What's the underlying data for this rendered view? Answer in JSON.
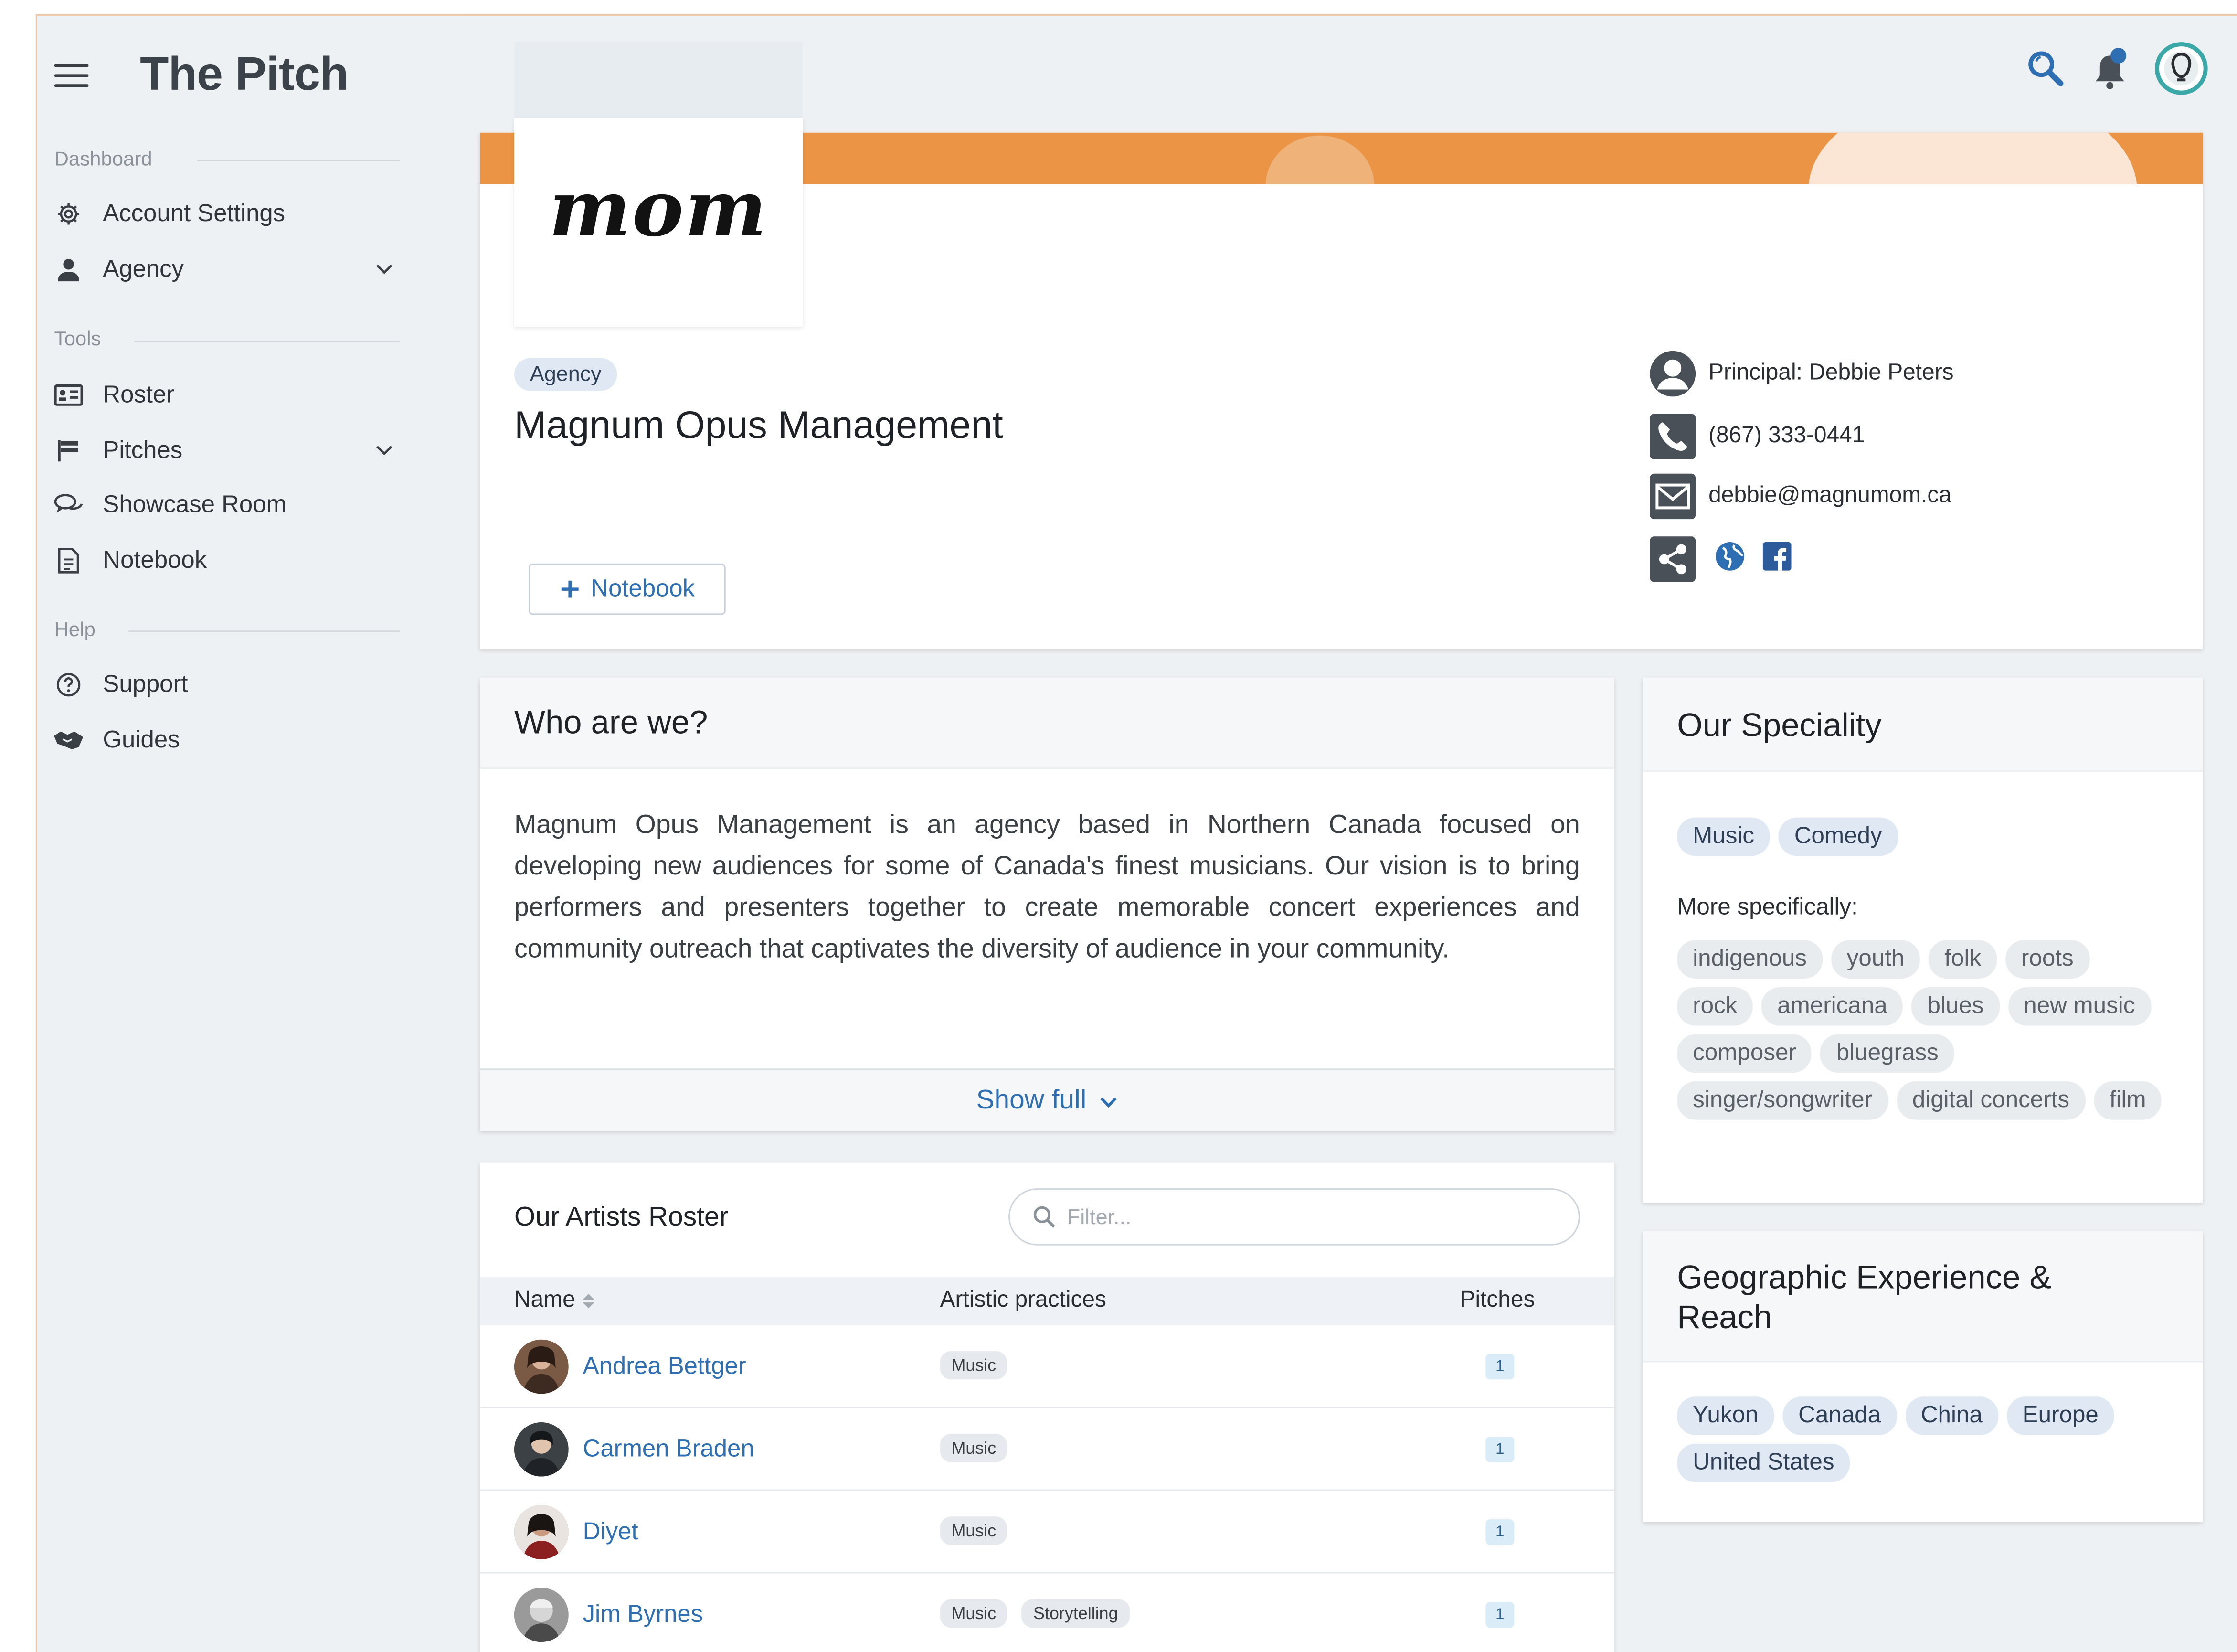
{
  "app": {
    "title": "The Pitch"
  },
  "sidebar": {
    "sections": [
      {
        "label": "Dashboard"
      },
      {
        "label": "Tools"
      },
      {
        "label": "Help"
      }
    ],
    "items": [
      {
        "label": "Account Settings",
        "icon": "gear-icon"
      },
      {
        "label": "Agency",
        "icon": "person-icon",
        "expandable": true
      },
      {
        "label": "Roster",
        "icon": "id-card-icon"
      },
      {
        "label": "Pitches",
        "icon": "flag-icon",
        "expandable": true
      },
      {
        "label": "Showcase Room",
        "icon": "chat-icon"
      },
      {
        "label": "Notebook",
        "icon": "document-icon"
      },
      {
        "label": "Support",
        "icon": "question-icon"
      },
      {
        "label": "Guides",
        "icon": "handshake-icon"
      }
    ]
  },
  "topbar": {
    "icons": [
      "search-icon",
      "bell-icon",
      "avatar-icon"
    ]
  },
  "profile": {
    "logo_text": "mom",
    "type_badge": "Agency",
    "name": "Magnum Opus Management",
    "notebook_button": "Notebook",
    "principal": "Principal: Debbie Peters",
    "phone": "(867) 333-0441",
    "email": "debbie@magnumom.ca"
  },
  "about": {
    "title": "Who are we?",
    "text": "Magnum Opus Management is an agency based in Northern Canada focused on developing new audiences for some of Canada's finest musicians. Our vision is to bring performers and presenters together to create memorable concert experiences and community outreach that captivates the diversity of audience in your community.",
    "show_full": "Show full"
  },
  "specialty": {
    "title": "Our Speciality",
    "primary": [
      "Music",
      "Comedy"
    ],
    "more_label": "More specifically:",
    "tags": [
      "indigenous",
      "youth",
      "folk",
      "roots",
      "rock",
      "americana",
      "blues",
      "new music",
      "composer",
      "bluegrass",
      "singer/songwriter",
      "digital concerts",
      "film"
    ]
  },
  "geo": {
    "title": "Geographic Experience & Reach",
    "tags": [
      "Yukon",
      "Canada",
      "China",
      "Europe",
      "United States"
    ]
  },
  "roster": {
    "title": "Our Artists Roster",
    "filter_placeholder": "Filter...",
    "columns": [
      "Name",
      "Artistic practices",
      "Pitches"
    ],
    "rows": [
      {
        "name": "Andrea Bettger",
        "practices": [
          "Music"
        ],
        "pitches": "1"
      },
      {
        "name": "Carmen Braden",
        "practices": [
          "Music"
        ],
        "pitches": "1"
      },
      {
        "name": "Diyet",
        "practices": [
          "Music"
        ],
        "pitches": "1"
      },
      {
        "name": "Jim Byrnes",
        "practices": [
          "Music",
          "Storytelling"
        ],
        "pitches": "1"
      }
    ]
  },
  "colors": {
    "accent": "#2e6fb4",
    "banner": "#ec9445",
    "badge_bg": "#dfe8f3"
  }
}
